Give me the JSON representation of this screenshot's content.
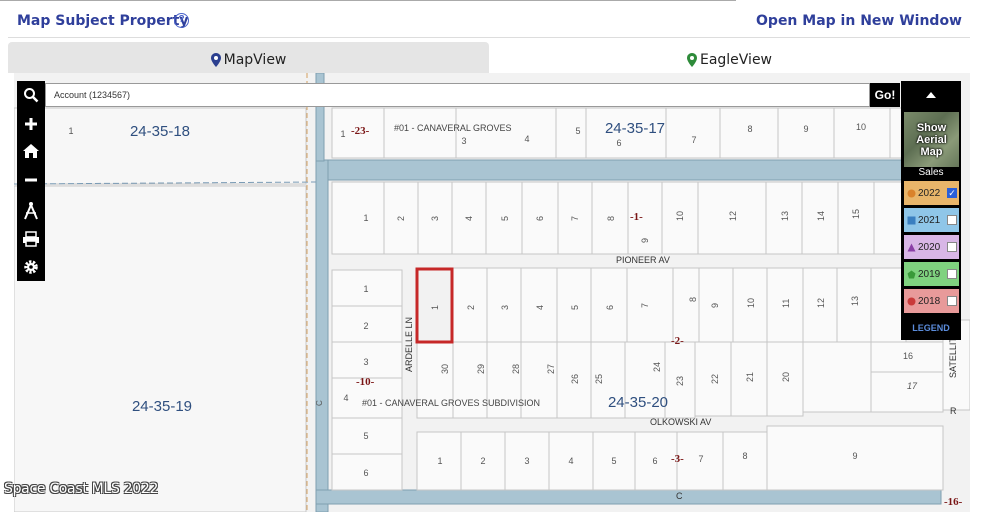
{
  "header": {
    "title": "Map Subject Property",
    "help": "?",
    "open_map_link": "Open Map in New Window"
  },
  "tabs": [
    {
      "label": "MapView",
      "active": true,
      "pin_color": "#2b3f8f"
    },
    {
      "label": "EagleView",
      "active": false,
      "pin_color": "#2e8b3a"
    }
  ],
  "search": {
    "value": "Account (1234567)",
    "go_label": "Go!"
  },
  "side_panel": {
    "aerial_label": "Show Aerial Map",
    "sales_label": "Sales",
    "years": [
      {
        "label": "2022",
        "checked": true,
        "color": "#e8b56a",
        "marker": "circle",
        "marker_color": "#d9822b"
      },
      {
        "label": "2021",
        "checked": false,
        "color": "#8fc6e8",
        "marker": "square",
        "marker_color": "#3a7fc0"
      },
      {
        "label": "2020",
        "checked": false,
        "color": "#d8b6e6",
        "marker": "triangle",
        "marker_color": "#8a3fa6"
      },
      {
        "label": "2019",
        "checked": false,
        "color": "#7fd27f",
        "marker": "pentagon",
        "marker_color": "#3a9a3a"
      },
      {
        "label": "2018",
        "checked": false,
        "color": "#e89a9a",
        "marker": "circle",
        "marker_color": "#c93a3a"
      }
    ],
    "legend_label": "LEGEND"
  },
  "map_labels": {
    "sections": [
      "24-35-18",
      "24-35-17",
      "24-35-19",
      "24-35-20"
    ],
    "subdivision_top": "#01 - CANAVERAL GROVES",
    "subdivision_bottom": "#01 - CANAVERAL GROVES SUBDIVISION",
    "streets": [
      "PIONEER AV",
      "OLKOWSKI AV",
      "ARDELLE LN",
      "SATELLITE"
    ],
    "blocks": [
      "-23-",
      "-1-",
      "-2-",
      "-10-",
      "-3-",
      "-16-"
    ],
    "road_c": "C",
    "road_r": "R"
  },
  "watermark": "Space Coast MLS 2022",
  "colors": {
    "header_text": "#2f3f9b",
    "water": "#a9c4d2",
    "subject_outline": "#c62828",
    "block_label": "#7a1515"
  }
}
